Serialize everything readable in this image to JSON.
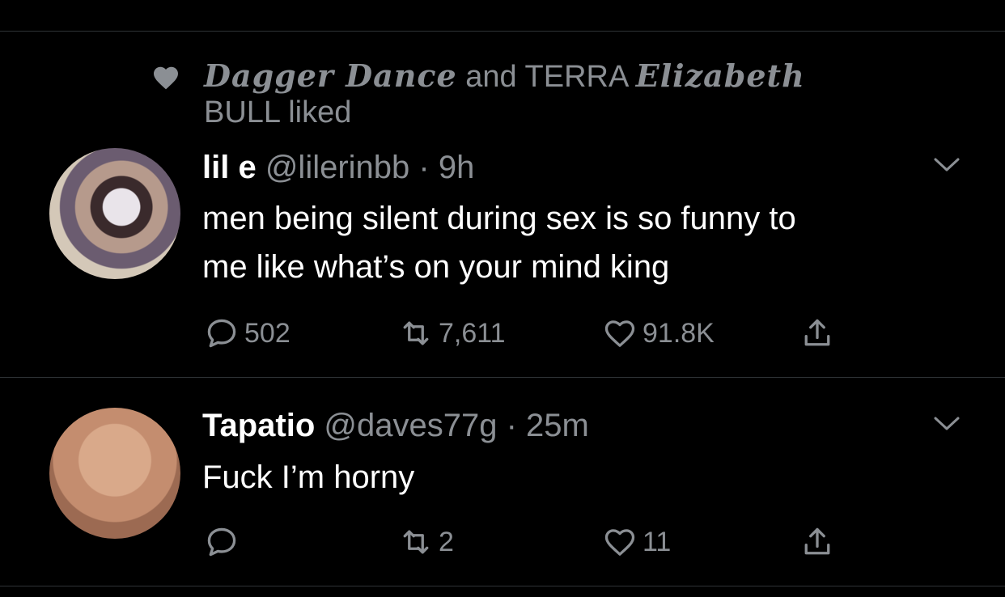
{
  "social_context": {
    "user1": "Dagger Dance",
    "connector": "and TERRA",
    "user2": "Elizabeth",
    "suffix": "BULL liked"
  },
  "tweets": [
    {
      "display_name": "lil e",
      "handle": "@lilerinbb",
      "time": "· 9h",
      "text_line1": "men being silent during sex is so funny to",
      "text_line2": "me like what’s on your mind king",
      "replies": "502",
      "retweets": "7,611",
      "likes": "91.8K"
    },
    {
      "display_name": "Tapatio",
      "handle": "@daves77g",
      "time": "· 25m",
      "text_line1": "Fuck I’m horny",
      "replies": "",
      "retweets": "2",
      "likes": "11"
    }
  ],
  "icons": {
    "social": "heart-icon",
    "reply": "reply-icon",
    "retweet": "retweet-icon",
    "like": "heart-outline-icon",
    "share": "share-icon",
    "menu": "chevron-down-icon"
  },
  "colors": {
    "background": "#000000",
    "primary_text": "#ffffff",
    "secondary_text": "#8b8f94",
    "divider": "#2f3336"
  }
}
